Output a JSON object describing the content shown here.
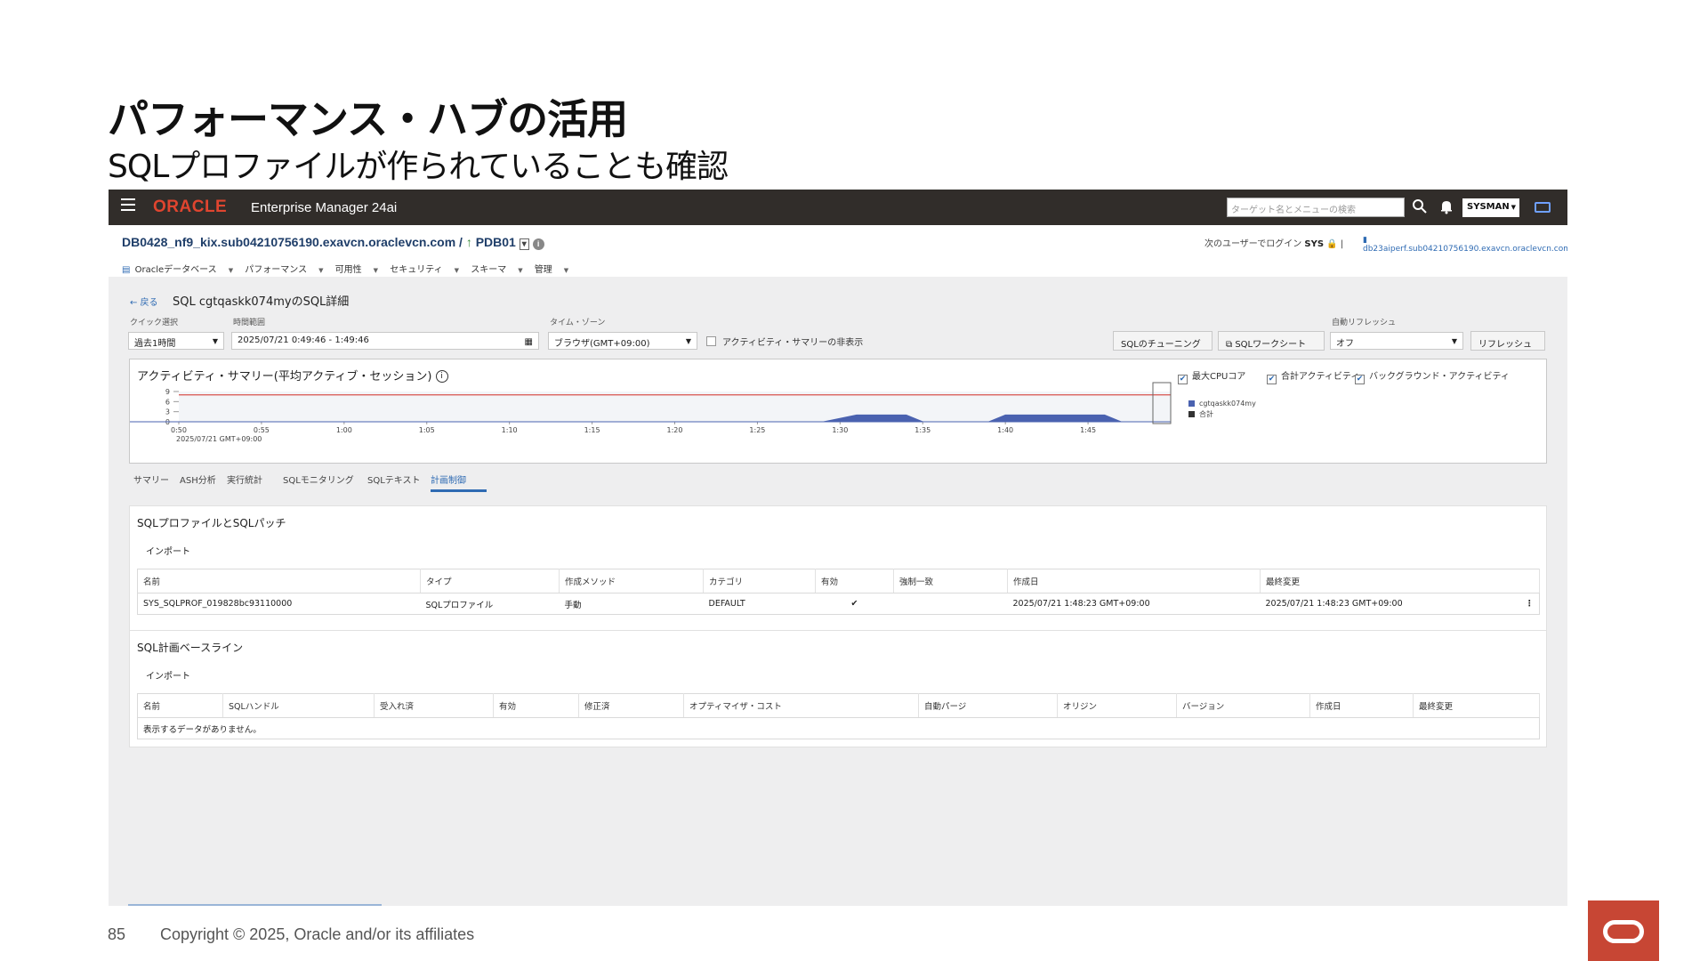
{
  "slide": {
    "title": "パフォーマンス・ハブの活用",
    "subtitle": "SQLプロファイルが作られていることも確認",
    "page_number": "85",
    "copyright": "Copyright © 2025, Oracle and/or its affiliates"
  },
  "topbar": {
    "logo": "ORACLE",
    "product": "Enterprise Manager 24ai",
    "search_placeholder": "ターゲット名とメニューの検索",
    "user": "SYSMAN"
  },
  "target": {
    "path": "DB0428_nf9_kix.sub04210756190.exavcn.oraclevcn.com /",
    "pdb": "PDB01",
    "login_prefix": "次のユーザーでログイン",
    "login_user": "SYS",
    "host": "db23aiperf.sub04210756190.exavcn.oraclevcn.com"
  },
  "menu": [
    "Oracleデータベース",
    "パフォーマンス",
    "可用性",
    "セキュリティ",
    "スキーマ",
    "管理"
  ],
  "page": {
    "back": "← 戻る",
    "heading": "SQL cgtqaskk074myのSQL詳細"
  },
  "controls": {
    "quick_label": "クイック選択",
    "quick_value": "過去1時間",
    "range_label": "時間範囲",
    "range_value": "2025/07/21 0:49:46 - 1:49:46",
    "tz_label": "タイム・ゾーン",
    "tz_value": "ブラウザ(GMT+09:00)",
    "hide_summary": "アクティビティ・サマリーの非表示",
    "btn_tuning": "SQLのチューニング",
    "btn_worksheet": "SQLワークシート",
    "refresh_label": "自動リフレッシュ",
    "refresh_value": "オフ",
    "btn_refresh": "リフレッシュ"
  },
  "chart_data": {
    "type": "area",
    "title": "アクティビティ・サマリー(平均アクティブ・セッション)",
    "y_ticks": [
      "9",
      "6",
      "3",
      "0"
    ],
    "ylim": [
      0,
      9
    ],
    "x_ticks": [
      "0:50",
      "0:55",
      "1:00",
      "1:05",
      "1:10",
      "1:15",
      "1:20",
      "1:25",
      "1:30",
      "1:35",
      "1:40",
      "1:45"
    ],
    "x_date": "2025/07/21 GMT+09:00",
    "max_cpu_core": 8,
    "legend_checks": [
      "最大CPUコア",
      "合計アクティビティ",
      "バックグラウンド・アクティビティ"
    ],
    "series": [
      {
        "name": "cgtqaskk074my",
        "color": "#4a62b0",
        "points": [
          [
            0,
            0
          ],
          [
            1.29,
            0
          ],
          [
            1.31,
            2
          ],
          [
            1.34,
            2
          ],
          [
            1.35,
            0
          ],
          [
            1.39,
            0
          ],
          [
            1.4,
            2
          ],
          [
            1.46,
            2
          ],
          [
            1.47,
            0
          ],
          [
            1.5,
            0
          ]
        ]
      },
      {
        "name": "合計",
        "color": "#333333",
        "points": []
      }
    ]
  },
  "tabs": [
    "サマリー",
    "ASH分析",
    "実行統計",
    "SQLモニタリング",
    "SQLテキスト",
    "計画制御"
  ],
  "profiles": {
    "title": "SQLプロファイルとSQLパッチ",
    "import": "インポート",
    "headers": [
      "名前",
      "タイプ",
      "作成メソッド",
      "カテゴリ",
      "有効",
      "強制一致",
      "作成日",
      "最終変更"
    ],
    "rows": [
      {
        "name": "SYS_SQLPROF_019828bc93110000",
        "type": "SQLプロファイル",
        "method": "手動",
        "category": "DEFAULT",
        "enabled": "✔",
        "force": "",
        "created": "2025/07/21 1:48:23 GMT+09:00",
        "modified": "2025/07/21 1:48:23 GMT+09:00"
      }
    ]
  },
  "baselines": {
    "title": "SQL計画ベースライン",
    "import": "インポート",
    "headers": [
      "名前",
      "SQLハンドル",
      "受入れ済",
      "有効",
      "修正済",
      "オプティマイザ・コスト",
      "自動パージ",
      "オリジン",
      "バージョン",
      "作成日",
      "最終変更"
    ],
    "empty": "表示するデータがありません。"
  }
}
